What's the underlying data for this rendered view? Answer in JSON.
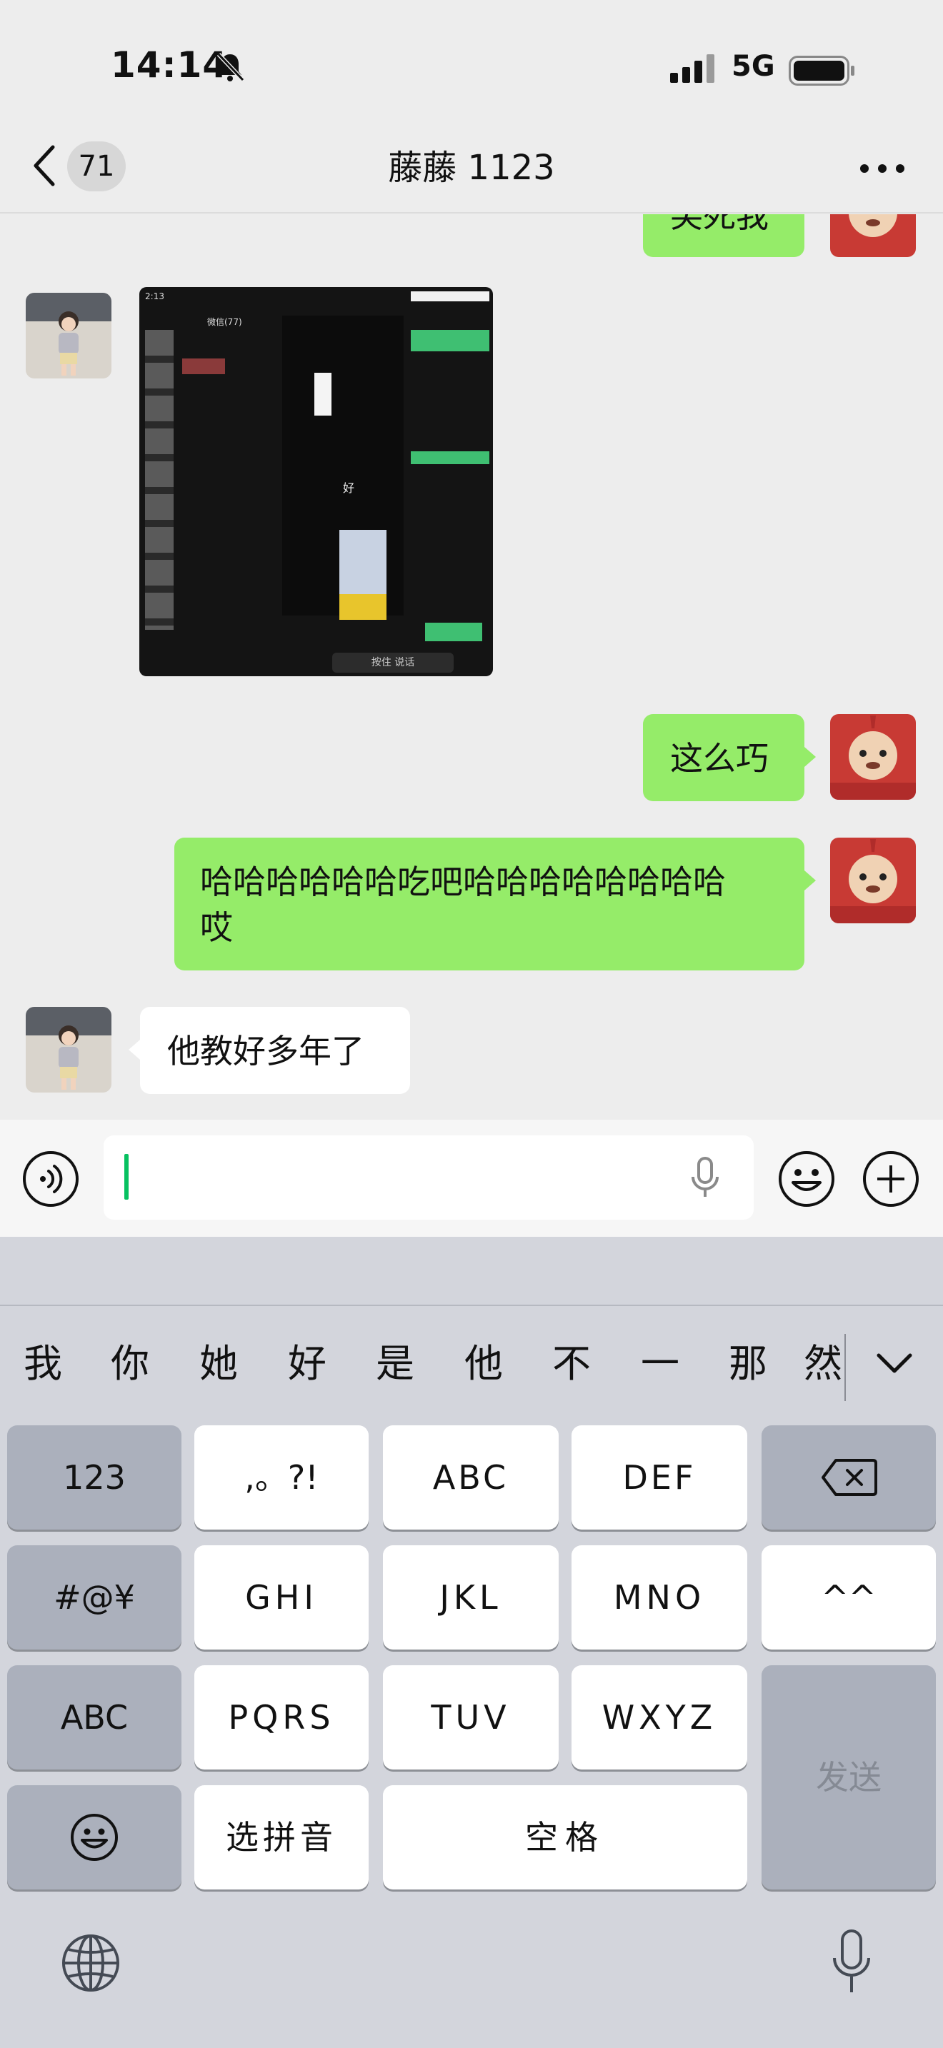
{
  "status_bar": {
    "time": "14:14",
    "network": "5G"
  },
  "nav": {
    "back_count": "71",
    "title": "藤藤 1123"
  },
  "messages": {
    "partial_top": "笑死我",
    "screenshot_title": "微信(77)",
    "screenshot_time": "2:13",
    "screenshot_reply": "好",
    "screenshot_button": "按住 说话",
    "msg_zhemeqiao": "这么巧",
    "msg_haha_line1": "哈哈哈哈哈哈吃吧哈哈哈哈哈哈哈哈",
    "msg_haha_line2": "哎",
    "msg_ta": "他教好多年了"
  },
  "keyboard": {
    "candidates": [
      "我",
      "你",
      "她",
      "好",
      "是",
      "他",
      "不",
      "一",
      "那",
      "然"
    ],
    "rows": {
      "r1": [
        "123",
        ",。?!",
        "ABC",
        "DEF"
      ],
      "r2": [
        "#@¥",
        "GHI",
        "JKL",
        "MNO",
        "^^"
      ],
      "r3": [
        "ABC",
        "PQRS",
        "TUV",
        "WXYZ"
      ],
      "r4_pinyin": "选拼音",
      "r4_space": "空格",
      "send": "发送"
    }
  },
  "icons": [
    "bell-slash-icon",
    "signal-icon",
    "battery-icon",
    "chevron-left-icon",
    "more-icon",
    "voice-icon",
    "microphone-icon",
    "emoji-icon",
    "plus-icon",
    "backspace-icon",
    "globe-icon",
    "chevron-down-icon"
  ],
  "colors": {
    "bubble_green": "#95ec69",
    "caret": "#07c160",
    "keyboard_bg": "#d3d5dc"
  }
}
